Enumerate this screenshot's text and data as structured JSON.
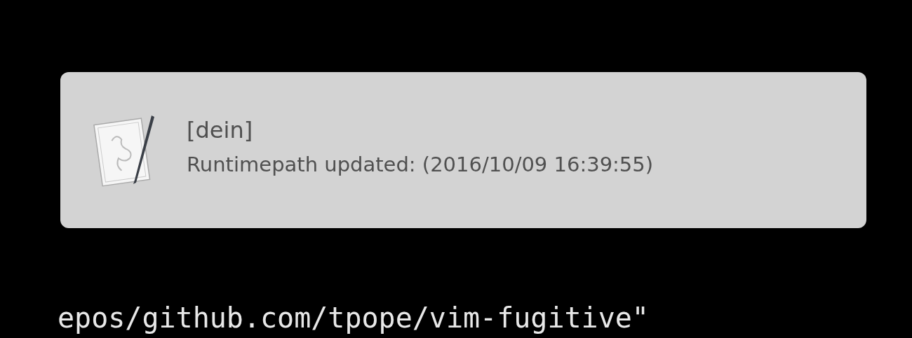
{
  "notification": {
    "title": "[dein]",
    "message": "Runtimepath updated: (2016/10/09 16:39:55)"
  },
  "terminal": {
    "lines": [
      "epos/github.com/tpope/vim-fugitive\""
    ]
  }
}
